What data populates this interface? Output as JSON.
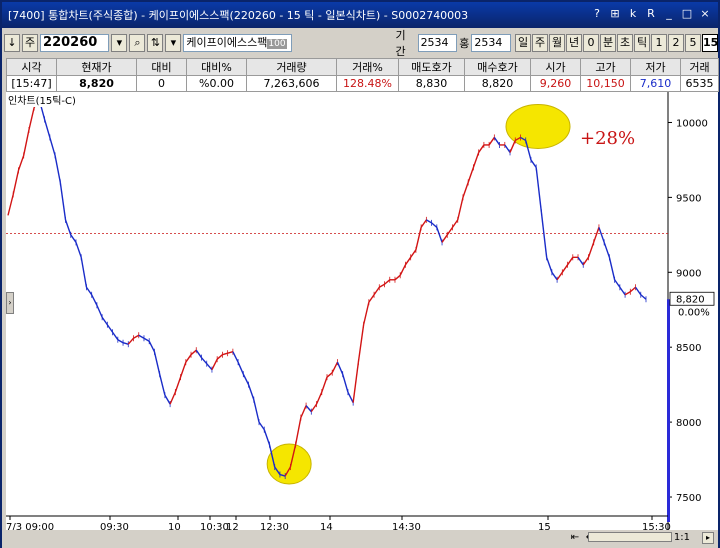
{
  "window": {
    "title": "[7400] 통합차트(주식종합) - 케이프이에스스팩(220260 - 15 틱 - 일본식차트) - S0002740003",
    "controls": [
      "?",
      "⊞",
      "k",
      "R",
      "_",
      "□",
      "×"
    ]
  },
  "toolbar": {
    "down_arrow": "↓",
    "stock_label": "주",
    "code": "220260",
    "name": "케이프이에스스팩",
    "name_tag": "100",
    "period_label": "기간",
    "period_value": "2534",
    "count_label": "홍",
    "count_value": "2534",
    "intervals": [
      "일",
      "주",
      "월",
      "년",
      "0",
      "분",
      "초",
      "틱",
      "1",
      "2",
      "5",
      "15"
    ],
    "active_interval": "15"
  },
  "quote_table": {
    "headers": [
      "시각",
      "현재가",
      "대비",
      "대비%",
      "거래량",
      "거래%",
      "매도호가",
      "매수호가",
      "시가",
      "고가",
      "저가",
      "거래"
    ],
    "values": [
      "[15:47]",
      "8,820",
      "0",
      "%0.00",
      "7,263,606",
      "128.48%",
      "8,830",
      "8,820",
      "9,260",
      "10,150",
      "7,610",
      "6535"
    ]
  },
  "chart_title": "인차트(15틱-C)",
  "colors": {
    "up": "#d21414",
    "down": "#1a2cc8",
    "highlight": "#f5e600",
    "annotation": "#c81414",
    "price_axis": "#2a2ad8"
  },
  "chart_data": {
    "type": "line",
    "title": "",
    "price_axis_ticks": [
      "10000",
      "9500",
      "9000",
      "8500",
      "8000",
      "7500"
    ],
    "ylim": [
      7400,
      10150
    ],
    "current_price_label": "8,820",
    "current_change_label": "0.00%",
    "reference_price": 9260,
    "x_ticks": [
      "7/3 09:00",
      "09:30",
      "10",
      "10:30",
      "12",
      "12:30",
      "14",
      "14:30",
      "15",
      "15:30"
    ],
    "series": [
      {
        "values": [
          9380,
          9520,
          9680,
          9780,
          9950,
          10100,
          10150,
          10020,
          9900,
          9780,
          9600,
          9350,
          9250,
          9200,
          9100,
          8900,
          8850,
          8780,
          8700,
          8650,
          8600,
          8550,
          8530,
          8520,
          8560,
          8580,
          8560,
          8540,
          8470,
          8320,
          8180,
          8120,
          8200,
          8300,
          8400,
          8450,
          8480,
          8430,
          8390,
          8350,
          8420,
          8450,
          8460,
          8470,
          8400,
          8320,
          8250,
          8150,
          8000,
          7950,
          7850,
          7700,
          7650,
          7640,
          7700,
          7850,
          8030,
          8110,
          8070,
          8120,
          8200,
          8300,
          8330,
          8400,
          8320,
          8200,
          8130,
          8400,
          8650,
          8800,
          8850,
          8900,
          8920,
          8950,
          8950,
          8980,
          9050,
          9100,
          9150,
          9300,
          9350,
          9330,
          9300,
          9200,
          9250,
          9300,
          9350,
          9500,
          9600,
          9700,
          9800,
          9850,
          9850,
          9900,
          9850,
          9850,
          9800,
          9880,
          9900,
          9880,
          9750,
          9700,
          9400,
          9100,
          9000,
          8950,
          9000,
          9050,
          9100,
          9100,
          9050,
          9100,
          9200,
          9300,
          9200,
          9100,
          8950,
          8900,
          8850,
          8870,
          8900,
          8850,
          8820
        ]
      }
    ],
    "annotations": [
      {
        "text": "+28%"
      }
    ]
  }
}
